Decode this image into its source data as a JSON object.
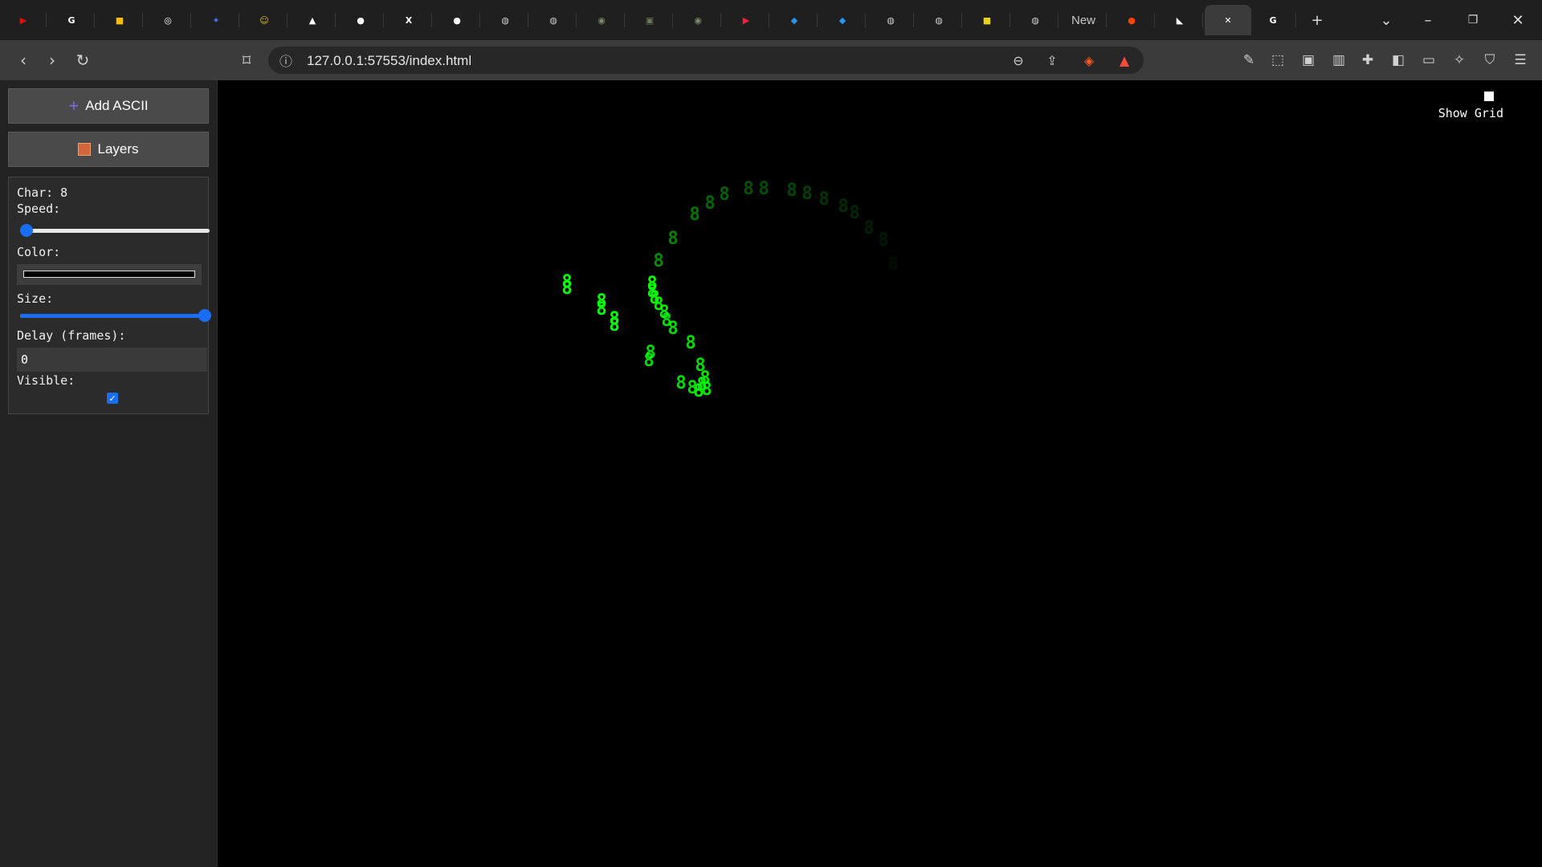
{
  "browser": {
    "tabs": [
      {
        "icon": "youtube-icon",
        "color": "#ff0000",
        "glyph": "▶"
      },
      {
        "icon": "google-icon",
        "color": "#ffffff",
        "glyph": "G"
      },
      {
        "icon": "keep-icon",
        "color": "#f9bb00",
        "glyph": "■"
      },
      {
        "icon": "openai-icon",
        "color": "#ffffff",
        "glyph": "◎"
      },
      {
        "icon": "bird-icon",
        "color": "#4b6fff",
        "glyph": "✦"
      },
      {
        "icon": "emoji-icon",
        "color": "#e8c020",
        "glyph": "☺"
      },
      {
        "icon": "triangle-icon",
        "color": "#ffffff",
        "glyph": "▲"
      },
      {
        "icon": "github-icon",
        "color": "#ffffff",
        "glyph": "●"
      },
      {
        "icon": "x-icon",
        "color": "#ffffff",
        "glyph": "X"
      },
      {
        "icon": "github-icon",
        "color": "#ffffff",
        "glyph": "●"
      },
      {
        "icon": "globe-icon",
        "color": "#cfcfcf",
        "glyph": "◍"
      },
      {
        "icon": "globe-icon",
        "color": "#cfcfcf",
        "glyph": "◍"
      },
      {
        "icon": "thumbnail-icon",
        "color": "#7a8a6a",
        "glyph": "◉"
      },
      {
        "icon": "thumbnail-icon",
        "color": "#6a7a5a",
        "glyph": "▣"
      },
      {
        "icon": "thumbnail-icon",
        "color": "#7a8a6a",
        "glyph": "◉"
      },
      {
        "icon": "youtube-music-icon",
        "color": "#ff1e3c",
        "glyph": "▶"
      },
      {
        "icon": "docker-icon",
        "color": "#2496ed",
        "glyph": "◆"
      },
      {
        "icon": "docker-icon",
        "color": "#2496ed",
        "glyph": "◆"
      },
      {
        "icon": "globe-icon",
        "color": "#cfcfcf",
        "glyph": "◍"
      },
      {
        "icon": "globe-icon",
        "color": "#cfcfcf",
        "glyph": "◍"
      },
      {
        "icon": "sticky-icon",
        "color": "#e8d020",
        "glyph": "■"
      },
      {
        "icon": "globe-icon",
        "color": "#cfcfcf",
        "glyph": "◍"
      },
      {
        "icon": "new-tab-text",
        "color": "#cfcfcf",
        "glyph": "New"
      },
      {
        "icon": "reddit-icon",
        "color": "#ff4500",
        "glyph": "●"
      },
      {
        "icon": "framer-icon",
        "color": "#ffffff",
        "glyph": "◣"
      },
      {
        "icon": "close-icon",
        "color": "#ffffff",
        "glyph": "✕"
      },
      {
        "icon": "google-icon",
        "color": "#ffffff",
        "glyph": "G"
      }
    ],
    "url": "127.0.0.1:57553/index.html"
  },
  "sidebar": {
    "add_ascii_label": "Add ASCII",
    "layers_label": "Layers"
  },
  "panel": {
    "char_label": "Char: 8",
    "speed_label": "Speed:",
    "speed_value": 0.02,
    "color_label": "Color:",
    "color_value": "#000000",
    "size_label": "Size:",
    "size_value": 1.0,
    "delay_label": "Delay (frames):",
    "delay_value": "0",
    "visible_label": "Visible:",
    "visible_checked": true
  },
  "canvas": {
    "show_grid_label": "Show Grid",
    "char": "8",
    "accent": "#00ff00"
  }
}
